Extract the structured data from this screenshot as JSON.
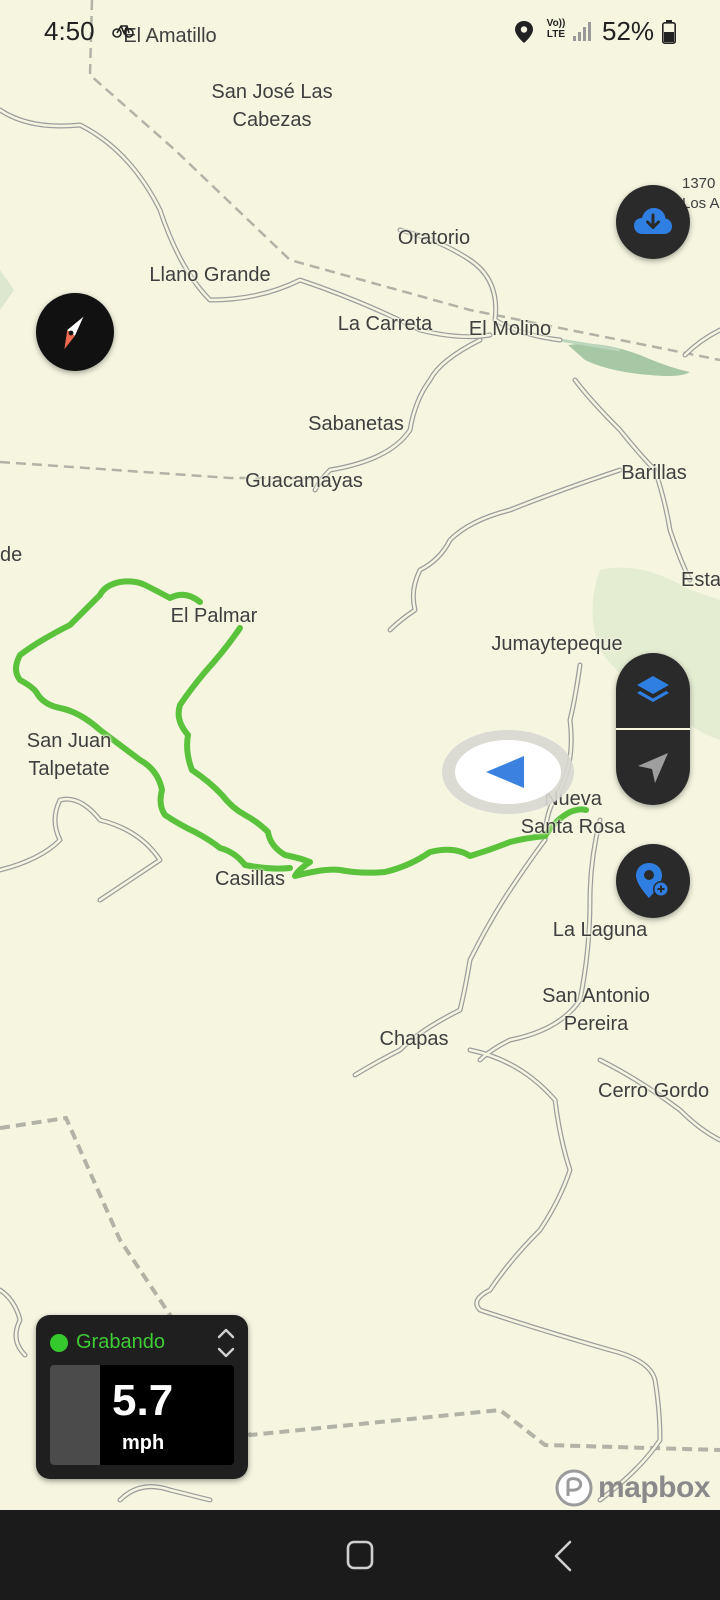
{
  "status_bar": {
    "time": "4:50",
    "network_label": "LTE",
    "battery_percent": "52%"
  },
  "map": {
    "places": [
      {
        "id": "el-amatillo",
        "name": "El Amatillo"
      },
      {
        "id": "san-jose-las-cabezas",
        "name": "San José Las\nCabezas"
      },
      {
        "id": "elevation-1370",
        "name": "1370\nLos A"
      },
      {
        "id": "oratorio",
        "name": "Oratorio"
      },
      {
        "id": "llano-grande",
        "name": "Llano Grande"
      },
      {
        "id": "la-carreta",
        "name": "La Carreta"
      },
      {
        "id": "el-molino",
        "name": "El Molino"
      },
      {
        "id": "sabanetas",
        "name": "Sabanetas"
      },
      {
        "id": "guacamayas",
        "name": "Guacamayas"
      },
      {
        "id": "barillas",
        "name": "Barillas"
      },
      {
        "id": "de-edge",
        "name": "de"
      },
      {
        "id": "esta-edge",
        "name": "Esta"
      },
      {
        "id": "el-palmar",
        "name": "El Palmar"
      },
      {
        "id": "jumaytepeque",
        "name": "Jumaytepeque"
      },
      {
        "id": "san-juan-talpetate",
        "name": "San Juan\nTalpetate"
      },
      {
        "id": "nueva-santa-rosa",
        "name": "Nueva\nSanta Rosa"
      },
      {
        "id": "casillas",
        "name": "Casillas"
      },
      {
        "id": "la-laguna",
        "name": "La Laguna"
      },
      {
        "id": "san-antonio-pereira",
        "name": "San Antonio\nPereira"
      },
      {
        "id": "chapas",
        "name": "Chapas"
      },
      {
        "id": "cerro-gordo",
        "name": "Cerro Gordo"
      }
    ],
    "track_color": "#5bc23c",
    "water_color": "#a7c8a4",
    "accent_color": "#2f7fe3",
    "compass_needle_color": "#f06a4f",
    "attribution": "mapbox"
  },
  "controls": {
    "download_icon": "cloud-download-icon",
    "compass_icon": "compass-icon",
    "layers_icon": "layers-icon",
    "locate_icon": "navigation-arrow-icon",
    "add_waypoint_icon": "add-location-pin-icon"
  },
  "recording": {
    "status": "Grabando",
    "speed": "5.7",
    "unit": "mph"
  }
}
